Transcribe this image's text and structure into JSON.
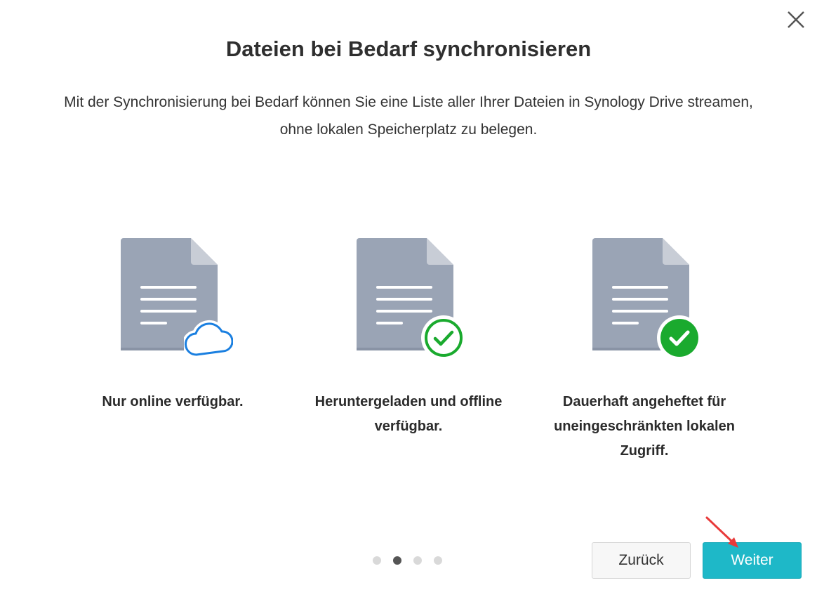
{
  "dialog": {
    "title": "Dateien bei Bedarf synchronisieren",
    "description": "Mit der Synchronisierung bei Bedarf können Sie eine Liste aller Ihrer Dateien in Synology Drive streamen, ohne lokalen Speicherplatz zu belegen."
  },
  "options": [
    {
      "icon": "document-cloud-icon",
      "caption": "Nur online verfügbar."
    },
    {
      "icon": "document-check-outline-icon",
      "caption": "Heruntergeladen und offline verfügbar."
    },
    {
      "icon": "document-check-filled-icon",
      "caption": "Dauerhaft angeheftet für uneingeschränkten lokalen Zugriff."
    }
  ],
  "pagination": {
    "total": 4,
    "current": 2
  },
  "buttons": {
    "back_label": "Zurück",
    "next_label": "Weiter"
  },
  "colors": {
    "doc_body": "#9aa4b5",
    "doc_fold": "#c8cdd6",
    "cloud_blue": "#1a7fe0",
    "check_green": "#1aaa2e",
    "accent_teal": "#1eb8c8",
    "annotation_red": "#e83a3a"
  }
}
